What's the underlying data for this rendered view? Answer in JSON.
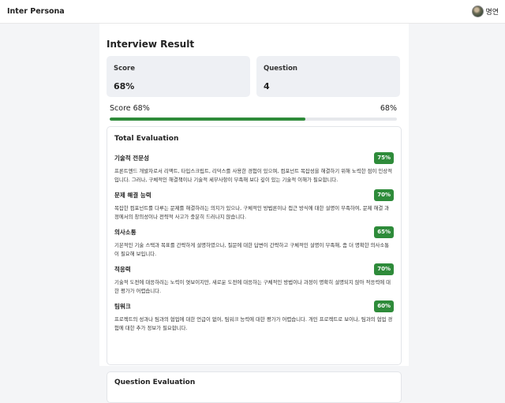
{
  "app": {
    "title": "Inter Persona"
  },
  "user": {
    "name": "명연"
  },
  "page": {
    "title": "Interview Result"
  },
  "stats": {
    "score_label": "Score",
    "score_value": "68%",
    "question_label": "Question",
    "question_value": "4"
  },
  "progress": {
    "label": "Score 68%",
    "value_text": "68%",
    "percent": 68
  },
  "total_eval": {
    "title": "Total Evaluation",
    "items": [
      {
        "name": "기술적 전문성",
        "score": "75%",
        "desc": "프론트엔드 개발자로서 리액트, 타입스크립트, 리덕스를 사용한 경험이 있으며, 컴포넌트 복잡성을 해결하기 위해 노력한 점이 인상적입니다. 그러나, 구체적인 해결책이나 기술적 세부사항이 부족해 보다 깊이 있는 기술적 이해가 필요합니다."
      },
      {
        "name": "문제 해결 능력",
        "score": "70%",
        "desc": "복잡한 컴포넌트를 다루는 문제를 해결하려는 의지가 있으나, 구체적인 방법론이나 접근 방식에 대한 설명이 부족하여, 문제 해결 과정에서의 창의성이나 전략적 사고가 충분히 드러나지 않습니다."
      },
      {
        "name": "의사소통",
        "score": "65%",
        "desc": "기본적인 기술 스택과 목표를 간략하게 설명하였으나, 질문에 대한 답변이 간략하고 구체적인 설명이 부족해, 좀 더 명확한 의사소통이 필요해 보입니다."
      },
      {
        "name": "적응력",
        "score": "70%",
        "desc": "기술적 도전에 대응하려는 노력이 엿보이지만, 새로운 도전에 대응하는 구체적인 방법이나 과정이 명확히 설명되지 않아 적응력에 대한 평가가 어렵습니다."
      },
      {
        "name": "팀워크",
        "score": "60%",
        "desc": "프로젝트의 성과나 팀과의 협업에 대한 언급이 없어, 팀워크 능력에 대한 평가가 어렵습니다. 개인 프로젝트로 보이나, 팀과의 협업 경험에 대한 추가 정보가 필요합니다."
      }
    ]
  },
  "question_eval": {
    "title": "Question Evaluation"
  },
  "colors": {
    "accent": "#2e8b3a",
    "card_bg": "#eef0f4",
    "page_bg": "#f4f5f7"
  }
}
